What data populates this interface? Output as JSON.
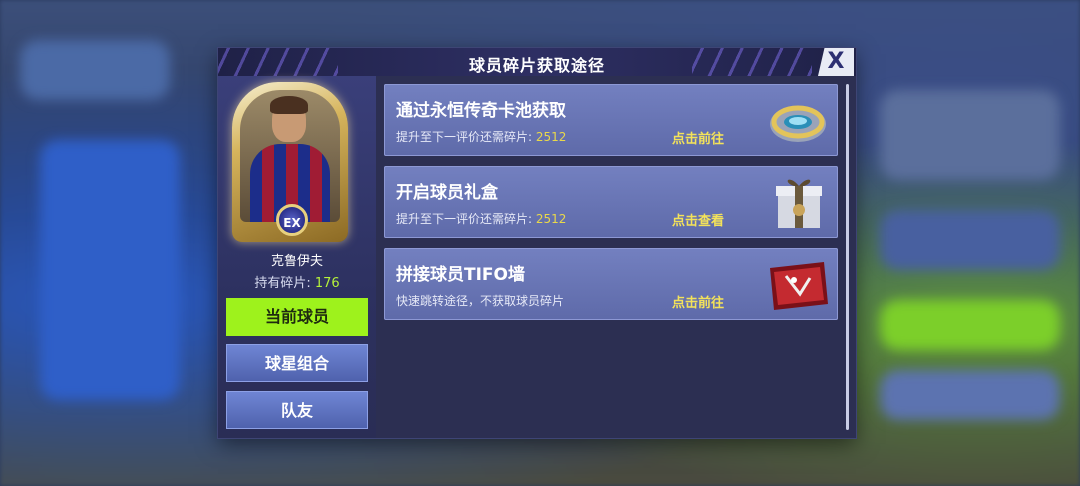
{
  "dialog": {
    "title": "球员碎片获取途径",
    "close_label": "X"
  },
  "player": {
    "name": "克鲁伊夫",
    "shards_label": "持有碎片:",
    "shards_count": "176",
    "badge": "EX"
  },
  "left_buttons": {
    "current": "当前球员",
    "star_combo": "球星组合",
    "teammates": "队友"
  },
  "sources": [
    {
      "title": "通过永恒传奇卡池获取",
      "subtitle": "提升至下一评价还需碎片:",
      "value": "2512",
      "action": "点击前往",
      "icon": "ring-icon"
    },
    {
      "title": "开启球员礼盒",
      "subtitle": "提升至下一评价还需碎片:",
      "value": "2512",
      "action": "点击查看",
      "icon": "gift-box-icon"
    },
    {
      "title": "拼接球员TIFO墙",
      "subtitle": "快速跳转途径，不获取球员碎片",
      "value": "",
      "action": "点击前往",
      "icon": "tifo-wall-icon"
    }
  ],
  "colors": {
    "accent_green": "#9ef21c",
    "action_yellow": "#f3e25a",
    "panel_bg": "#2c2f52"
  }
}
